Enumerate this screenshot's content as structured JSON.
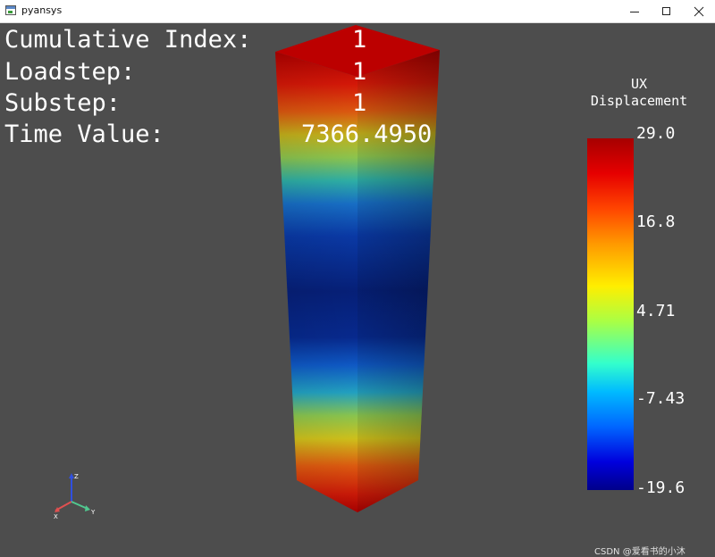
{
  "window": {
    "title": "pyansys"
  },
  "overlay": {
    "rows": [
      {
        "label": "Cumulative Index:",
        "value": "1"
      },
      {
        "label": "Loadstep:",
        "value": "1"
      },
      {
        "label": "Substep:",
        "value": "1"
      },
      {
        "label": "Time Value:",
        "value": "7366.4950"
      }
    ]
  },
  "scalar_bar": {
    "title_line1": "UX",
    "title_line2": "Displacement",
    "ticks": [
      "29.0",
      "16.8",
      "4.71",
      "-7.43",
      "-19.6"
    ]
  },
  "axes": {
    "x": "X",
    "y": "Y",
    "z": "Z"
  },
  "watermark": "CSDN @爱看书的小沐",
  "colors": {
    "background": "#4d4d4d",
    "text": "#ffffff",
    "axis_x": "#e05050",
    "axis_y": "#50c890",
    "axis_z": "#3050e0"
  }
}
